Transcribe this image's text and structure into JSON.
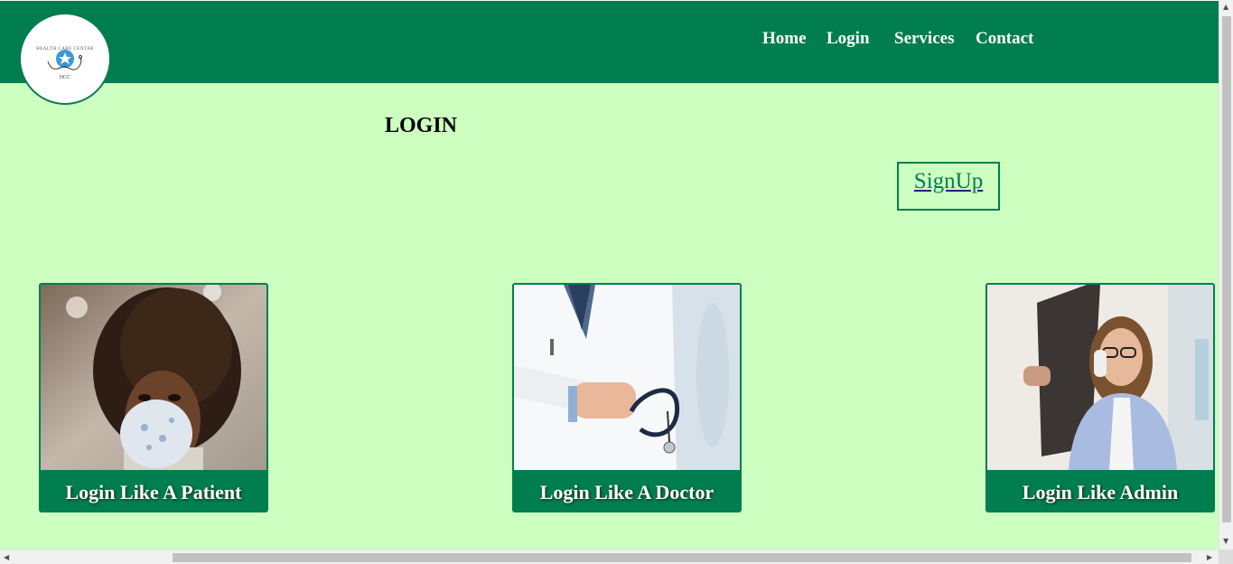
{
  "logo": {
    "top_text": "HEALTH CARE CENTER",
    "bottom_text": "HCC"
  },
  "nav": {
    "items": [
      "Home",
      "Login",
      "Services",
      "Contact"
    ]
  },
  "page": {
    "title": "LOGIN",
    "signup_label": "SignUp"
  },
  "cards": [
    {
      "label": "Login Like A Patient",
      "image": "woman-in-face-mask-photo"
    },
    {
      "label": "Login Like A Doctor",
      "image": "doctor-with-stethoscope-photo"
    },
    {
      "label": "Login Like Admin",
      "image": "receptionist-on-phone-photo"
    }
  ],
  "colors": {
    "header": "#007e4f",
    "background": "#ccffc0",
    "accent": "#007e4f"
  }
}
